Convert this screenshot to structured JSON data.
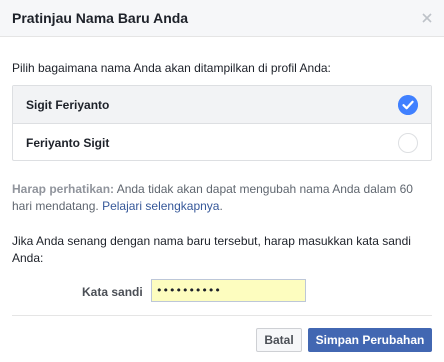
{
  "dialog": {
    "title": "Pratinjau Nama Baru Anda",
    "close_icon": "close-icon"
  },
  "intro_text": "Pilih bagaimana nama Anda akan ditampilkan di profil Anda:",
  "name_options": [
    {
      "label": "Sigit Feriyanto",
      "selected": true
    },
    {
      "label": "Feriyanto Sigit",
      "selected": false
    }
  ],
  "notice": {
    "bold_prefix": "Harap perhatikan:",
    "text": " Anda tidak akan dapat mengubah nama Anda dalam 60 hari mendatang. ",
    "link": "Pelajari selengkapnya",
    "suffix": "."
  },
  "password_prompt": "Jika Anda senang dengan nama baru tersebut, harap masukkan kata sandi Anda:",
  "password_field": {
    "label": "Kata sandi",
    "value": "••••••••••"
  },
  "buttons": {
    "cancel": "Batal",
    "save": "Simpan Perubahan"
  },
  "colors": {
    "accent": "#4080ff",
    "primary_button": "#4267b2",
    "link": "#365899",
    "input_bg": "#fdfdbf"
  }
}
